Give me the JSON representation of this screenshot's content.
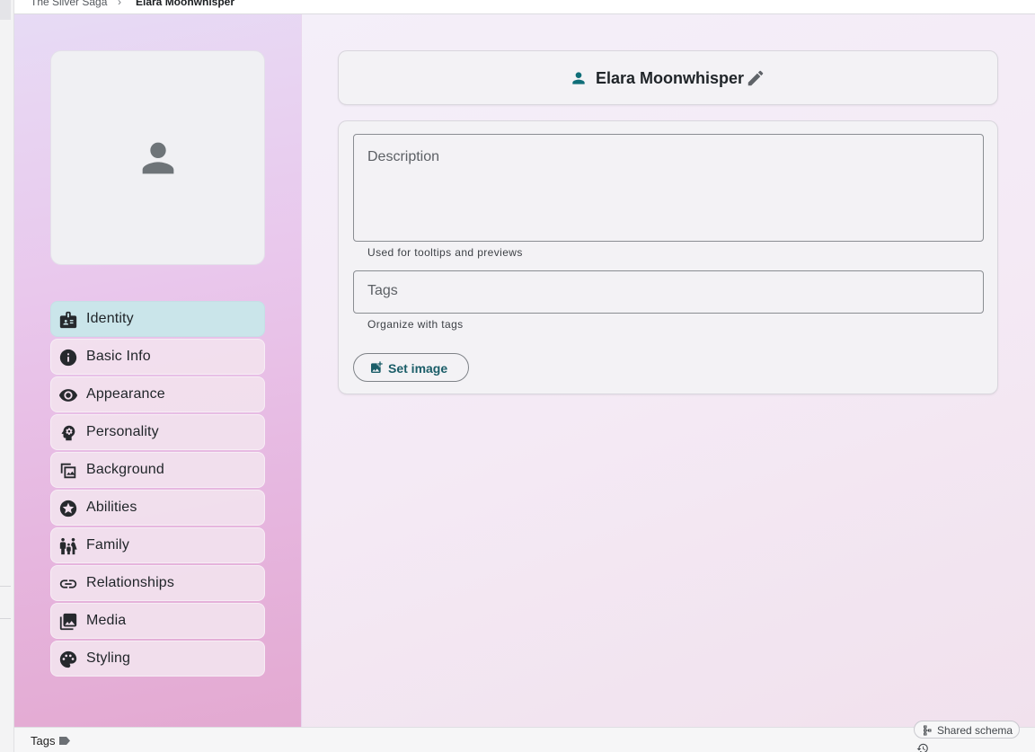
{
  "breadcrumb": {
    "items": [
      "The Silver Saga",
      "Elara Moonwhisper"
    ],
    "separator": ">"
  },
  "avatar": {
    "icon": "person-icon"
  },
  "nav": {
    "items": [
      {
        "label": "Identity",
        "icon": "id-badge-icon",
        "active": true
      },
      {
        "label": "Basic Info",
        "icon": "info-icon",
        "active": false
      },
      {
        "label": "Appearance",
        "icon": "eye-icon",
        "active": false
      },
      {
        "label": "Personality",
        "icon": "head-gear-icon",
        "active": false
      },
      {
        "label": "Background",
        "icon": "landscape-icon",
        "active": false
      },
      {
        "label": "Abilities",
        "icon": "star-icon",
        "active": false
      },
      {
        "label": "Family",
        "icon": "family-icon",
        "active": false
      },
      {
        "label": "Relationships",
        "icon": "link-icon",
        "active": false
      },
      {
        "label": "Media",
        "icon": "photo-library-icon",
        "active": false
      },
      {
        "label": "Styling",
        "icon": "palette-icon",
        "active": false
      }
    ]
  },
  "header": {
    "name": "Elara Moonwhisper",
    "person_icon": "person-icon",
    "edit_icon": "pencil-icon"
  },
  "form": {
    "description": {
      "placeholder": "Description",
      "hint": "Used for tooltips and previews"
    },
    "tags": {
      "placeholder": "Tags",
      "hint": "Organize with tags"
    },
    "set_image_label": "Set image"
  },
  "footer": {
    "tags_label": "Tags",
    "schema_label": "Shared schema"
  },
  "colors": {
    "accent": "#1a5d68",
    "active_nav": "#cae5ea",
    "icon_teal": "#0f6e78"
  }
}
